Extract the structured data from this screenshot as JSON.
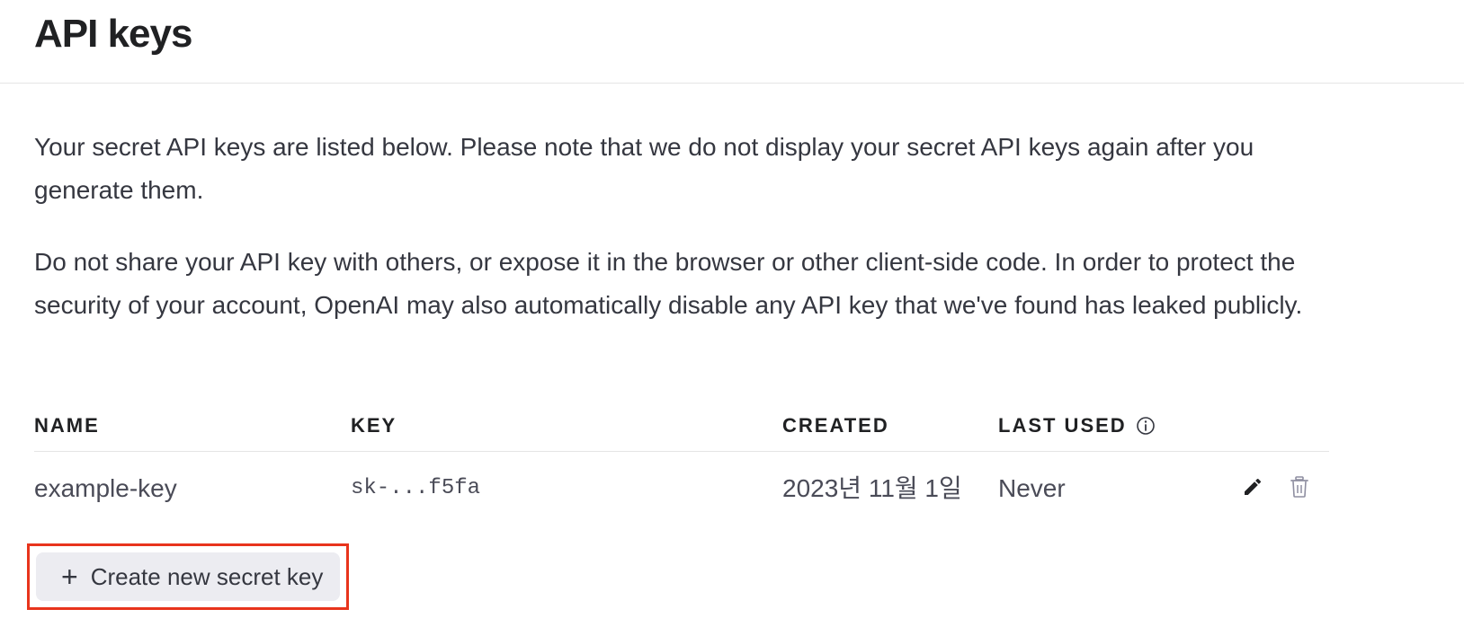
{
  "page": {
    "title": "API keys"
  },
  "intro": {
    "paragraph1": "Your secret API keys are listed below. Please note that we do not display your secret API keys again after you generate them.",
    "paragraph2": "Do not share your API key with others, or expose it in the browser or other client-side code. In order to protect the security of your account, OpenAI may also automatically disable any API key that we've found has leaked publicly."
  },
  "table": {
    "columns": {
      "name": "NAME",
      "key": "KEY",
      "created": "CREATED",
      "last_used": "LAST USED"
    },
    "rows": [
      {
        "name": "example-key",
        "key": "sk-...f5fa",
        "created": "2023년 11월 1일",
        "last_used": "Never"
      }
    ]
  },
  "actions": {
    "create_label": "Create new secret key",
    "create_icon": "plus-icon",
    "edit_icon": "pencil-icon",
    "delete_icon": "trash-icon",
    "info_icon": "info-icon"
  },
  "colors": {
    "highlight_border": "#e8341c",
    "button_bg": "#ececf1"
  }
}
